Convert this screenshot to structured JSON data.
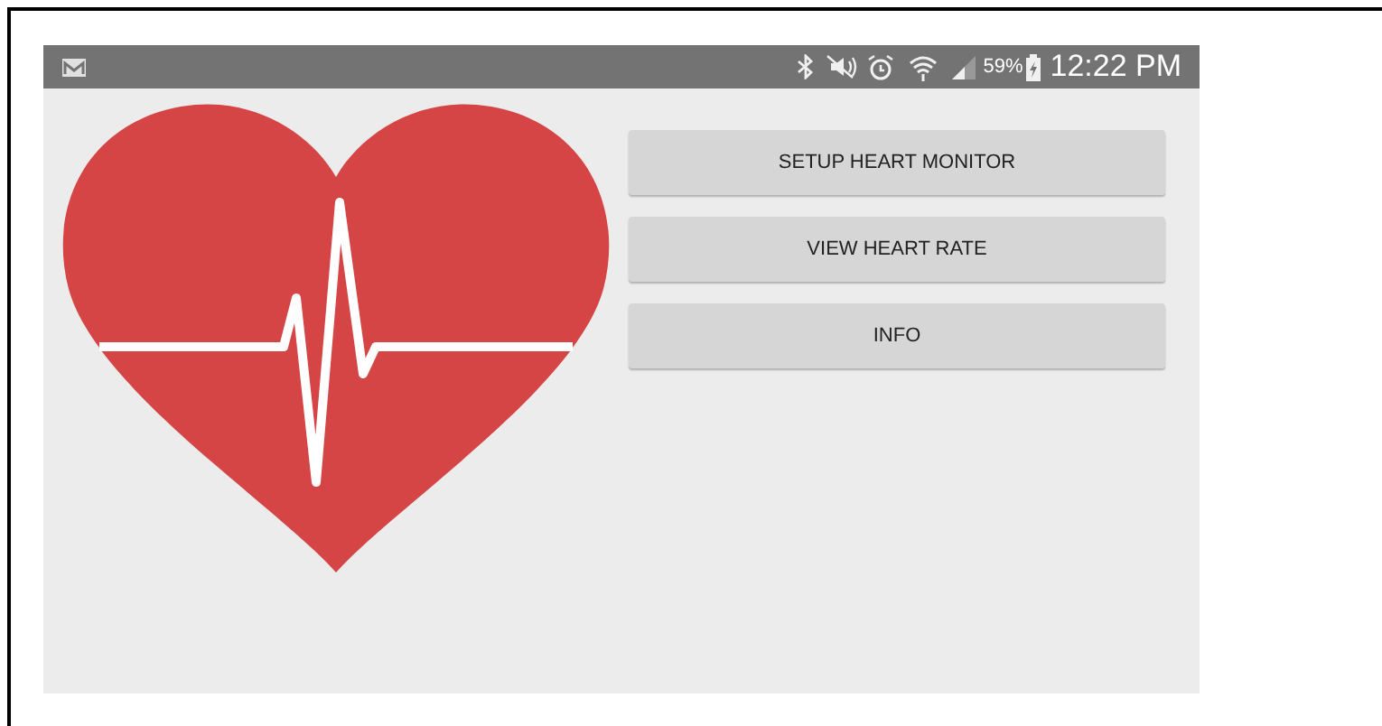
{
  "status_bar": {
    "battery_percent": "59%",
    "time": "12:22 PM"
  },
  "buttons": [
    {
      "label": "SETUP HEART MONITOR"
    },
    {
      "label": "VIEW HEART RATE"
    },
    {
      "label": "INFO"
    }
  ]
}
